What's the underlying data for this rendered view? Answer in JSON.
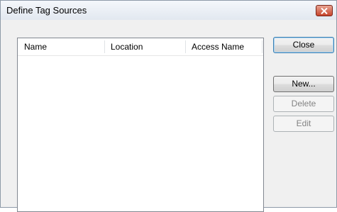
{
  "window": {
    "title": "Define Tag Sources"
  },
  "list": {
    "columns": [
      "Name",
      "Location",
      "Access Name"
    ],
    "rows": []
  },
  "buttons": {
    "close_label": "Close",
    "new_label": "New...",
    "delete_label": "Delete",
    "edit_label": "Edit"
  },
  "colors": {
    "title_close_button": "#c7452c",
    "window_background": "#f0f0f0",
    "list_background": "#ffffff"
  }
}
